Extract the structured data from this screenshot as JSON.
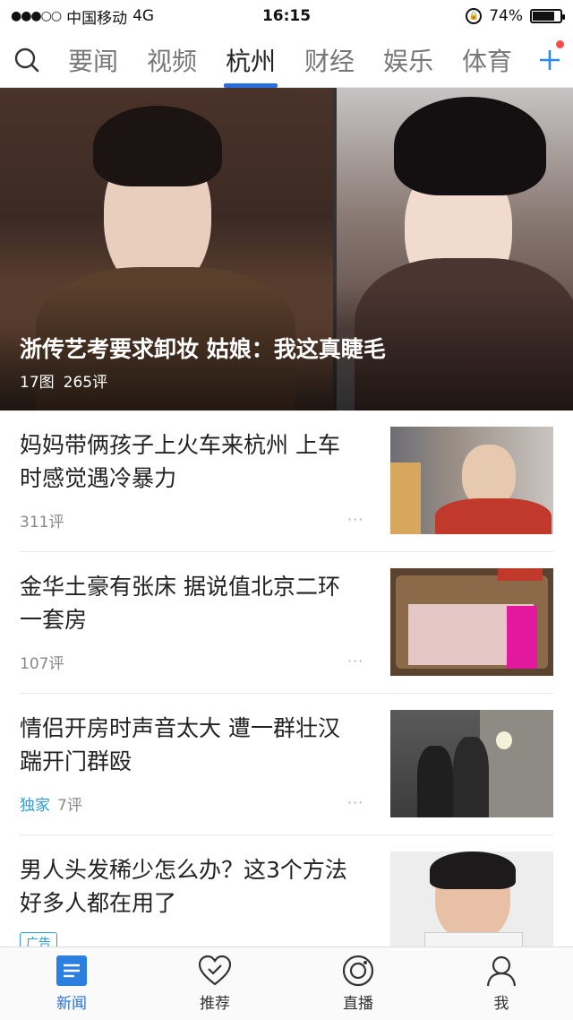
{
  "status_bar": {
    "carrier": "中国移动",
    "network": "4G",
    "time": "16:15",
    "battery": "74%",
    "battery_level": 0.74
  },
  "top_nav": {
    "tabs": [
      {
        "label": "要闻"
      },
      {
        "label": "视频"
      },
      {
        "label": "杭州",
        "active": true
      },
      {
        "label": "财经"
      },
      {
        "label": "娱乐"
      },
      {
        "label": "体育"
      }
    ],
    "accent": "#2a6fdb"
  },
  "hero": {
    "title": "浙传艺考要求卸妆 姑娘：我这真睫毛",
    "photos": "17图",
    "comments": "265评"
  },
  "feed": [
    {
      "title": "妈妈带俩孩子上火车来杭州 上车时感觉遇冷暴力",
      "tag": "",
      "comments": "311评",
      "more": "···"
    },
    {
      "title": "金华土豪有张床 据说值北京二环一套房",
      "tag": "",
      "comments": "107评",
      "more": "···"
    },
    {
      "title": "情侣开房时声音太大 遭一群壮汉踹开门群殴",
      "tag": "独家",
      "comments": "7评",
      "more": "···"
    },
    {
      "title": "男人头发稀少怎么办？这3个方法好多人都在用了",
      "tag": "广告",
      "comments": "",
      "more": ""
    }
  ],
  "tab_bar": {
    "items": [
      {
        "label": "新闻",
        "icon": "news-icon",
        "active": true
      },
      {
        "label": "推荐",
        "icon": "heart-check-icon"
      },
      {
        "label": "直播",
        "icon": "live-icon"
      },
      {
        "label": "我",
        "icon": "person-icon"
      }
    ]
  }
}
